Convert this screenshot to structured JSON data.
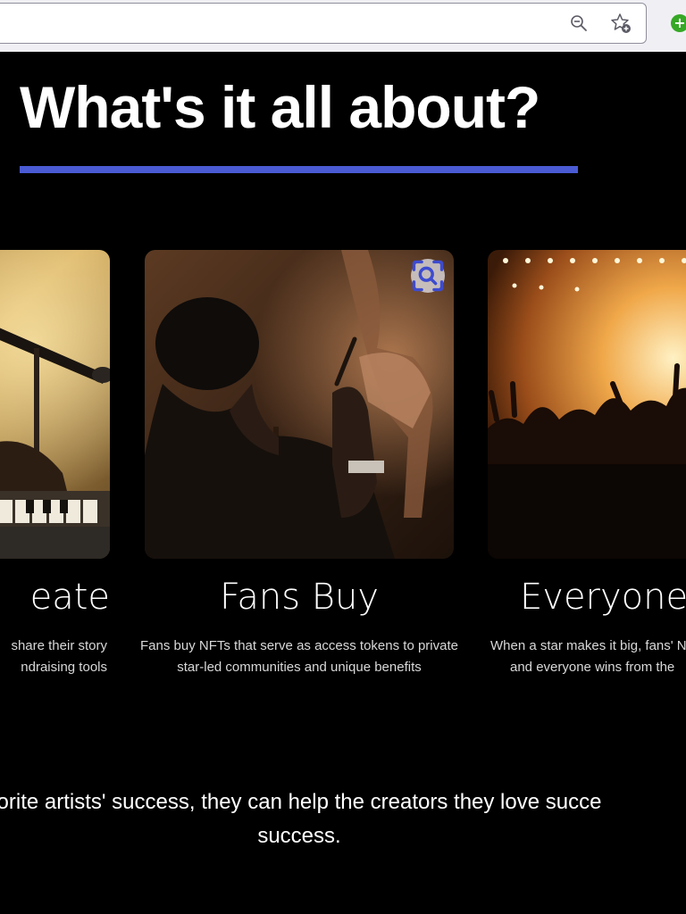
{
  "browser": {
    "zoom_icon": "zoom-out-icon",
    "bookmark_icon": "star-add-icon",
    "extension_icon": "plus-icon",
    "extension_symbol": "+"
  },
  "section": {
    "heading": "What's it all about?",
    "accent_color": "#4a5bd4"
  },
  "cards": [
    {
      "title": "eate",
      "desc_line1": "share their story",
      "desc_line2": "ndraising tools",
      "image": "musician at microphone and piano"
    },
    {
      "title": "Fans Buy",
      "desc": "Fans buy NFTs that serve as access tokens to private star-led communities and unique benefits",
      "image": "man with drink watching performer",
      "lens_icon": "visual-search-icon"
    },
    {
      "title": "Everyone V",
      "desc_line1": "When a star makes it big, fans' N",
      "desc_line2": "and everyone wins from the",
      "image": "concert crowd with stage lights"
    }
  ],
  "closing": {
    "line1": "orite artists' success, they can help the creators they love succe",
    "line2": "success."
  }
}
